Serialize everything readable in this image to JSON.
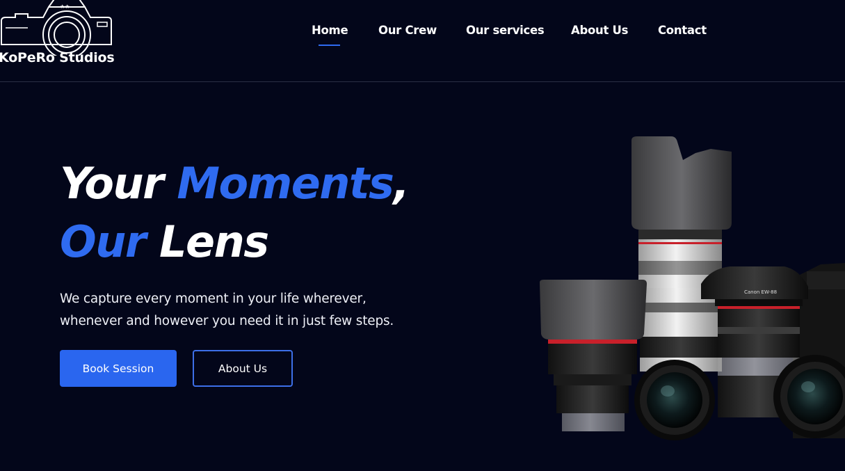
{
  "brand": {
    "name": "KoPeRo Studios"
  },
  "nav": {
    "items": [
      {
        "label": "Home",
        "active": true
      },
      {
        "label": "Our Crew",
        "active": false
      },
      {
        "label": "Our services",
        "active": false
      },
      {
        "label": "About Us",
        "active": false
      },
      {
        "label": "Contact",
        "active": false
      }
    ]
  },
  "hero": {
    "title_part1": "Your ",
    "title_part2": "Moments",
    "title_part3": ",",
    "title_part4": "Our",
    "title_part5": " Lens",
    "description": "We capture every moment in your life wherever, whenever and however you need it in just few steps.",
    "primary_button": "Book Session",
    "secondary_button": "About Us"
  },
  "colors": {
    "background": "#03061a",
    "accent": "#2f6bf0",
    "text": "#ffffff"
  },
  "icons": {
    "logo": "camera-logo-icon",
    "hero_image": "camera-lenses-image"
  }
}
